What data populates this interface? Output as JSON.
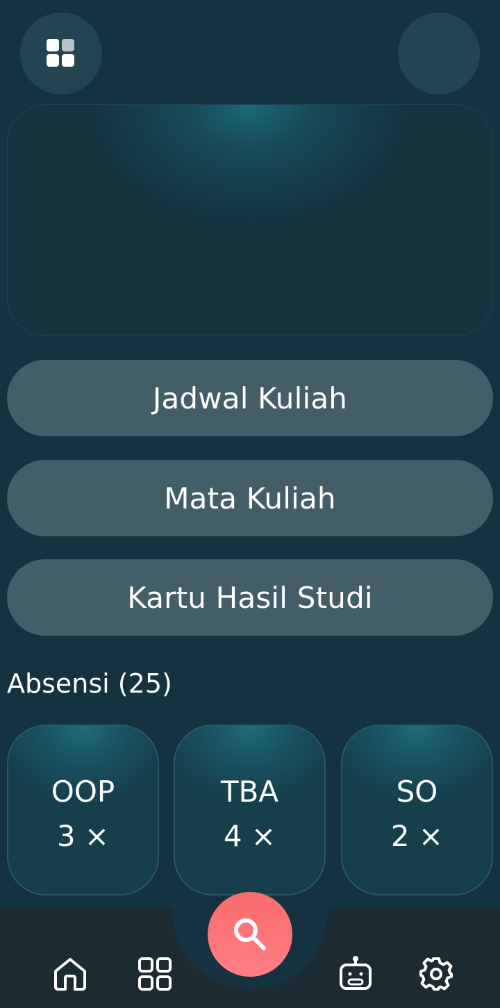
{
  "header": {
    "menu_icon": "grid-menu-icon",
    "avatar_icon": "avatar"
  },
  "menu": {
    "buttons": [
      {
        "label": "Jadwal Kuliah"
      },
      {
        "label": "Mata Kuliah"
      },
      {
        "label": "Kartu Hasil Studi"
      }
    ]
  },
  "attendance": {
    "title": "Absensi (25)",
    "items": [
      {
        "name": "OOP",
        "count": "3 ×"
      },
      {
        "name": "TBA",
        "count": "4 ×"
      },
      {
        "name": "SO",
        "count": "2 ×"
      }
    ]
  },
  "bottom_nav": {
    "items": [
      "home-icon",
      "apps-icon",
      "search-icon",
      "robot-icon",
      "gear-icon"
    ]
  },
  "colors": {
    "background": "#14323f",
    "pill": "#435e68",
    "fab": "#fb7478",
    "nav_bar": "#1c2b31"
  }
}
